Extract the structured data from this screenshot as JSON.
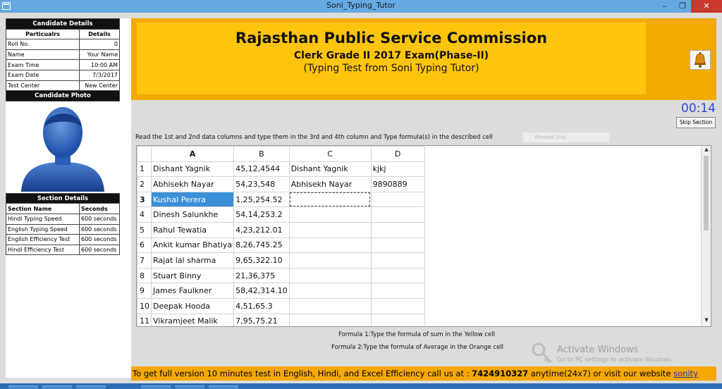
{
  "window": {
    "title": "Soni_Typing_Tutor",
    "minimize": "–",
    "maximize": "❐",
    "close": "✕"
  },
  "candidate": {
    "header": "Candidate Details",
    "col_particulars": "Particualrs",
    "col_details": "Details",
    "rows": [
      {
        "label": "Roll No.",
        "value": "0"
      },
      {
        "label": "Name",
        "value": "Your Name"
      },
      {
        "label": "Exam Time",
        "value": "10:00 AM"
      },
      {
        "label": "Exam Date",
        "value": "7/3/2017"
      },
      {
        "label": "Test Center",
        "value": "New Center"
      }
    ],
    "photo_header": "Candidate Photo"
  },
  "sections": {
    "header": "Section Details",
    "col_name": "Section Name",
    "col_seconds": "Seconds",
    "rows": [
      {
        "name": "Hindi Typing Speed",
        "seconds": "600 seconds"
      },
      {
        "name": "English Typing Speed",
        "seconds": "600 seconds"
      },
      {
        "name": "English Efficiency Test",
        "seconds": "600 seconds"
      },
      {
        "name": "Hindi  Efficiency Test",
        "seconds": "600 seconds"
      }
    ]
  },
  "banner": {
    "title": "Rajasthan Public Service Commission",
    "subtitle": "Clerk Grade II 2017 Exam(Phase-II)",
    "tagline": "(Typing Test from Soni Typing Tutor)",
    "bell_icon": "bell-icon"
  },
  "timer": "00:14",
  "skip_label": "Skip Section",
  "instructions": "Read the 1st and 2nd data columns and type them in the 3rd and 4th column and Type formula(s) in the described cell",
  "ghost_label": "Window Snip",
  "sheet": {
    "columns": [
      "A",
      "B",
      "C",
      "D"
    ],
    "rows": [
      {
        "n": "1",
        "a": "Dishant Yagnik",
        "b": "45,12,4544",
        "c": "Dishant Yagnik",
        "d": "kjkj"
      },
      {
        "n": "2",
        "a": "Abhisekh Nayar",
        "b": "54,23,548",
        "c": "Abhisekh Nayar",
        "d": "9890889"
      },
      {
        "n": "3",
        "a": "Kushal Perera",
        "b": "1,25,254.52",
        "c": "",
        "d": ""
      },
      {
        "n": "4",
        "a": "Dinesh Salunkhe",
        "b": "54,14,253.2",
        "c": "",
        "d": ""
      },
      {
        "n": "5",
        "a": "Rahul Tewatia",
        "b": "4,23,212.01",
        "c": "",
        "d": ""
      },
      {
        "n": "6",
        "a": "Ankit kumar Bhatiya",
        "b": "8,26,745.25",
        "c": "",
        "d": ""
      },
      {
        "n": "7",
        "a": "Rajat lal sharma",
        "b": "9,65,322.10",
        "c": "",
        "d": ""
      },
      {
        "n": "8",
        "a": "Stuart Binny",
        "b": "21,36,375",
        "c": "",
        "d": ""
      },
      {
        "n": "9",
        "a": "James Faulkner",
        "b": "58,42,314.10",
        "c": "",
        "d": ""
      },
      {
        "n": "10",
        "a": "Deepak Hooda",
        "b": "4,51,65.3",
        "c": "",
        "d": ""
      },
      {
        "n": "11",
        "a": "Vikramjeet Malik",
        "b": "7,95,75.21",
        "c": "",
        "d": ""
      }
    ],
    "scroll_up": "▲",
    "scroll_down": "▼"
  },
  "formulas": {
    "f1": "Formula 1:Type the formula of sum in the Yellow cell",
    "f2": "Formula 2:Type the formula of Average in the Orange cell"
  },
  "watermark": {
    "line1": "Activate Windows",
    "line2": "Go to PC settings to activate Windows."
  },
  "footer": {
    "part1": "To get full version 10 minutes test in English, Hindi, and Excel Efficiency call us at : ",
    "phone": "7424910327",
    "part2": " anytime(24x7) or visit our website ",
    "link": "sonity"
  },
  "colors": {
    "banner_outer": "#f2a900",
    "banner_inner": "#ffc40c",
    "selected_cell": "#3a8fd8",
    "timer": "#2c46d8",
    "titlebar": "#65a9e3"
  }
}
